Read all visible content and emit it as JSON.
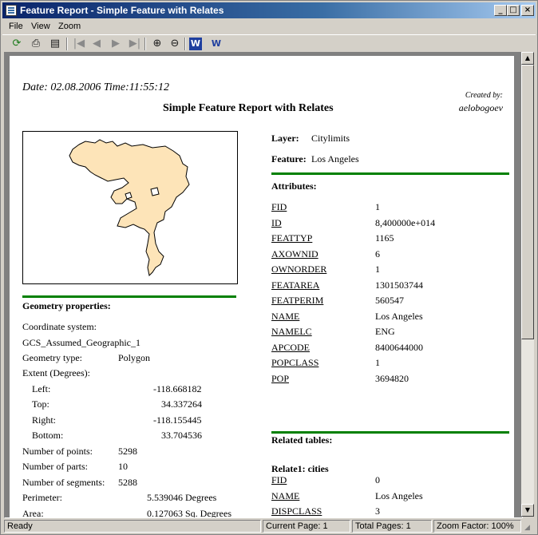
{
  "window": {
    "title": "Feature Report - Simple Feature with Relates"
  },
  "menu": [
    "File",
    "View",
    "Zoom"
  ],
  "toolbar": {
    "refresh": "⟳",
    "print": "⎙",
    "page_setup": "▤",
    "first": "|◀",
    "prev": "◀",
    "next": "▶",
    "last": "▶|",
    "zoom_in": "⊕",
    "zoom_out": "⊖",
    "word": "W",
    "word_export": "W"
  },
  "colors": {
    "polygon_fill": "#fde4b8",
    "divider": "#008000",
    "title_bar": "#0a246a"
  },
  "report": {
    "date_line": "Date: 02.08.2006 Time:11:55:12",
    "created_by_label": "Created by:",
    "created_by": "aelobogoev",
    "title": "Simple Feature Report with Relates",
    "layer_label": "Layer:",
    "layer_value": "Citylimits",
    "feature_label": "Feature:",
    "feature_value": "Los Angeles",
    "attributes_label": "Attributes:",
    "attributes": [
      {
        "name": "FID",
        "value": "1"
      },
      {
        "name": "ID",
        "value": "8,400000e+014"
      },
      {
        "name": "FEATTYP",
        "value": "1165"
      },
      {
        "name": "AXOWNID",
        "value": "6"
      },
      {
        "name": "OWNORDER",
        "value": "1"
      },
      {
        "name": "FEATAREA",
        "value": "1301503744"
      },
      {
        "name": "FEATPERIM",
        "value": "560547"
      },
      {
        "name": "NAME",
        "value": "Los Angeles"
      },
      {
        "name": "NAMELC",
        "value": "ENG"
      },
      {
        "name": "APCODE",
        "value": "8400644000"
      },
      {
        "name": "POPCLASS",
        "value": "1"
      },
      {
        "name": "POP",
        "value": "3694820"
      }
    ],
    "related_label": "Related tables:",
    "relate_name": "Relate1: cities",
    "related": [
      {
        "name": "FID",
        "value": "0"
      },
      {
        "name": "NAME",
        "value": "Los Angeles"
      },
      {
        "name": "DISPCLASS",
        "value": "3"
      }
    ],
    "geometry": {
      "header": "Geometry properties:",
      "coord_label": "Coordinate system:",
      "coord_value": "GCS_Assumed_Geographic_1",
      "type_label": "Geometry type:",
      "type_value": "Polygon",
      "extent_label": "Extent (Degrees):",
      "left_label": "Left:",
      "left_value": "-118.668182",
      "top_label": "Top:",
      "top_value": "34.337264",
      "right_label": "Right:",
      "right_value": "-118.155445",
      "bottom_label": "Bottom:",
      "bottom_value": "33.704536",
      "points_label": "Number of points:",
      "points_value": "5298",
      "parts_label": "Number of parts:",
      "parts_value": "10",
      "segments_label": "Number of segments:",
      "segments_value": "5288",
      "perimeter_label": "Perimeter:",
      "perimeter_value": "5.539046  Degrees",
      "area_label": "Area:",
      "area_value": "0.127063  Sq. Degrees"
    }
  },
  "status": {
    "ready": "Ready",
    "current_page": "Current Page: 1",
    "total_pages": "Total Pages: 1",
    "zoom": "Zoom Factor: 100%"
  }
}
